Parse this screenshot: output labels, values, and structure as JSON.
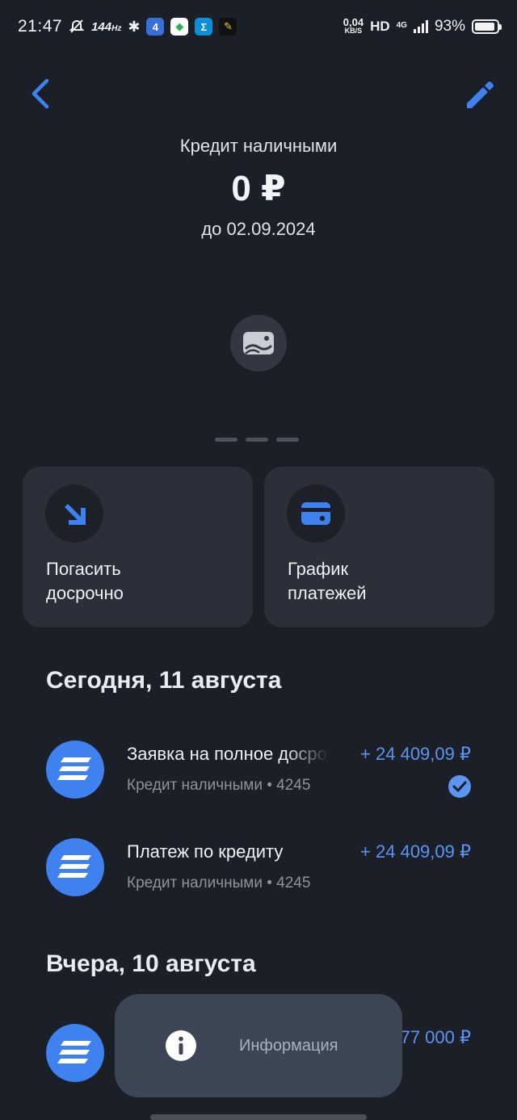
{
  "status_bar": {
    "time": "21:47",
    "refresh_rate": "144",
    "refresh_unit": "Hz",
    "net_speed": "0,04",
    "net_speed_unit": "KB/S",
    "hd": "HD",
    "network": "4G",
    "battery": "93%"
  },
  "header": {
    "product": "Кредит наличными",
    "amount": "0 ₽",
    "due": "до 02.09.2024"
  },
  "actions": [
    {
      "label": "Погасить\nдосрочно",
      "icon": "arrow-down-right-icon"
    },
    {
      "label": "График\nплатежей",
      "icon": "card-icon"
    }
  ],
  "sections": [
    {
      "title": "Сегодня, 11 августа",
      "items": [
        {
          "title": "Заявка на полное досрочное погашение",
          "subtitle": "Кредит наличными • 4245",
          "amount": "+ 24 409,09 ₽",
          "completed": true
        },
        {
          "title": "Платеж по кредиту",
          "subtitle": "Кредит наличными • 4245",
          "amount": "+ 24 409,09 ₽",
          "completed": false
        }
      ]
    },
    {
      "title": "Вчера, 10 августа",
      "items": [
        {
          "title": "",
          "subtitle": "",
          "amount": "77 000 ₽",
          "completed": false
        }
      ]
    }
  ],
  "toast": {
    "text": "Информация",
    "icon": "info-icon"
  },
  "colors": {
    "background": "#1b1f27",
    "card": "#2a2f39",
    "accent": "#3f82ef",
    "amount": "#5c95f1"
  }
}
